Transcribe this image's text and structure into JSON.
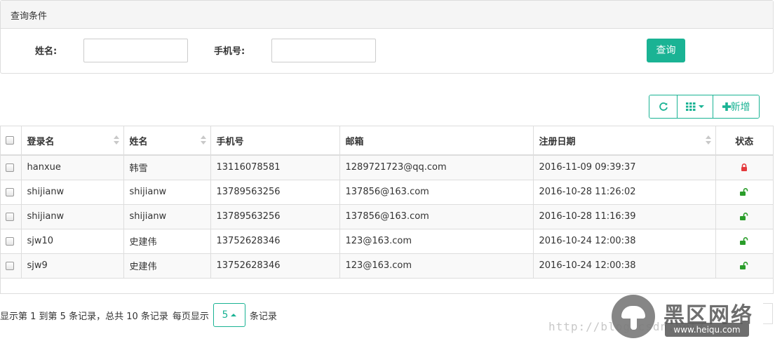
{
  "query": {
    "title": "查询条件",
    "name_label": "姓名:",
    "name_value": "",
    "phone_label": "手机号:",
    "phone_value": "",
    "search_button": "查询"
  },
  "toolbar": {
    "refresh_icon": "refresh-icon",
    "columns_icon": "grid-columns-icon",
    "add_label": "新增",
    "add_icon": "plus-icon"
  },
  "table": {
    "columns": [
      "登录名",
      "姓名",
      "手机号",
      "邮箱",
      "注册日期",
      "状态"
    ],
    "rows": [
      {
        "login": "hanxue",
        "name": "韩雪",
        "phone": "13116078581",
        "email": "1289721723@qq.com",
        "date": "2016-11-09 09:39:37",
        "status": "locked"
      },
      {
        "login": "shijianw",
        "name": "shijianw",
        "phone": "13789563256",
        "email": "137856@163.com",
        "date": "2016-10-28 11:26:02",
        "status": "unlocked"
      },
      {
        "login": "shijianw",
        "name": "shijianw",
        "phone": "13789563256",
        "email": "137856@163.com",
        "date": "2016-10-28 11:16:39",
        "status": "unlocked"
      },
      {
        "login": "sjw10",
        "name": "史建伟",
        "phone": "13752628346",
        "email": "123@163.com",
        "date": "2016-10-24 12:00:38",
        "status": "unlocked"
      },
      {
        "login": "sjw9",
        "name": "史建伟",
        "phone": "13752628346",
        "email": "123@163.com",
        "date": "2016-10-24 12:00:38",
        "status": "unlocked"
      }
    ]
  },
  "pagination": {
    "info": "显示第 1 到第 5 条记录，总共 10 条记录",
    "per_page_prefix": "每页显示",
    "page_size": "5",
    "per_page_suffix": "条记录"
  },
  "watermark": {
    "brand": "黑区网络",
    "site": "www.heiqu.com",
    "url": "http://blog.csdn.net/"
  },
  "colors": {
    "accent": "#1ab394",
    "locked": "#e4393c",
    "unlocked": "#2a9d2a",
    "header_bg": "#f5f5f5",
    "stripe_bg": "#f9f9f9",
    "border": "#dddddd"
  }
}
